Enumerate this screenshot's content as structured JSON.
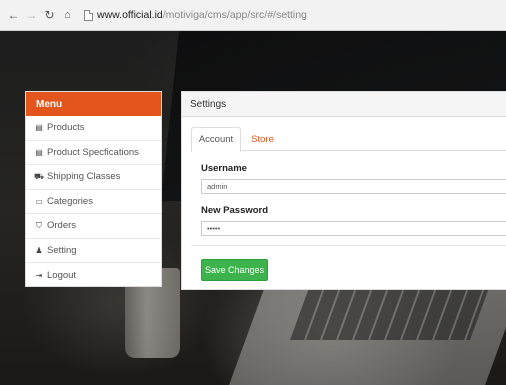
{
  "browser": {
    "url_host": "www.official.id",
    "url_path": "/motiviga/cms/app/src/#/setting"
  },
  "menu": {
    "title": "Menu",
    "items": [
      {
        "label": "Products",
        "icon": "table-icon",
        "glyph": "▤"
      },
      {
        "label": "Product Specfications",
        "icon": "table-icon",
        "glyph": "▤"
      },
      {
        "label": "Shipping Classes",
        "icon": "truck-icon",
        "glyph": "⛟"
      },
      {
        "label": "Categories",
        "icon": "folder-icon",
        "glyph": "▭"
      },
      {
        "label": "Orders",
        "icon": "cart-icon",
        "glyph": "⛉"
      },
      {
        "label": "Setting",
        "icon": "user-icon",
        "glyph": "♟"
      },
      {
        "label": "Logout",
        "icon": "sign-out-icon",
        "glyph": "⇥"
      }
    ]
  },
  "settings": {
    "title": "Settings",
    "tabs": [
      {
        "label": "Account",
        "active": true
      },
      {
        "label": "Store",
        "active": false
      }
    ],
    "username_label": "Username",
    "username_value": "admin",
    "password_label": "New Password",
    "password_value": "•••••",
    "save_label": "Save Changes"
  },
  "colors": {
    "accent": "#e2561d",
    "save_button": "#3cb44b"
  }
}
